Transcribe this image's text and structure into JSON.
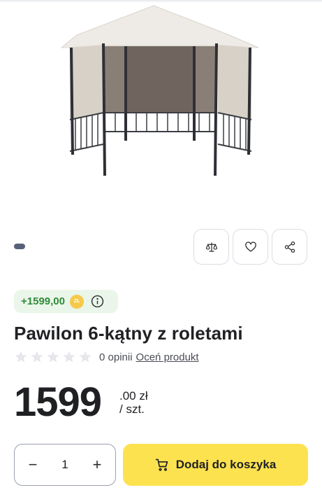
{
  "product": {
    "title": "Pawilon 6-kątny z roletami",
    "image_alt_name": "hexagonal-gazebo-with-blinds"
  },
  "loyalty": {
    "points": "+1599,00",
    "coin_label": "ZŁ"
  },
  "rating": {
    "stars_filled": 0,
    "stars_total": 5,
    "opinions": "0 opinii",
    "rate_link": "Oceń produkt"
  },
  "price": {
    "integer": "1599",
    "decimals": ".00 zł",
    "unit": "/ szt."
  },
  "cart": {
    "quantity": "1",
    "minus": "−",
    "plus": "+",
    "add_label": "Dodaj do koszyka"
  },
  "actions": {
    "compare_icon": "scale-icon",
    "favorite_icon": "heart-icon",
    "share_icon": "share-icon"
  },
  "colors": {
    "accent_yellow": "#fde24f",
    "points_green": "#2f8a3a",
    "points_bg": "#eaf6e9"
  }
}
